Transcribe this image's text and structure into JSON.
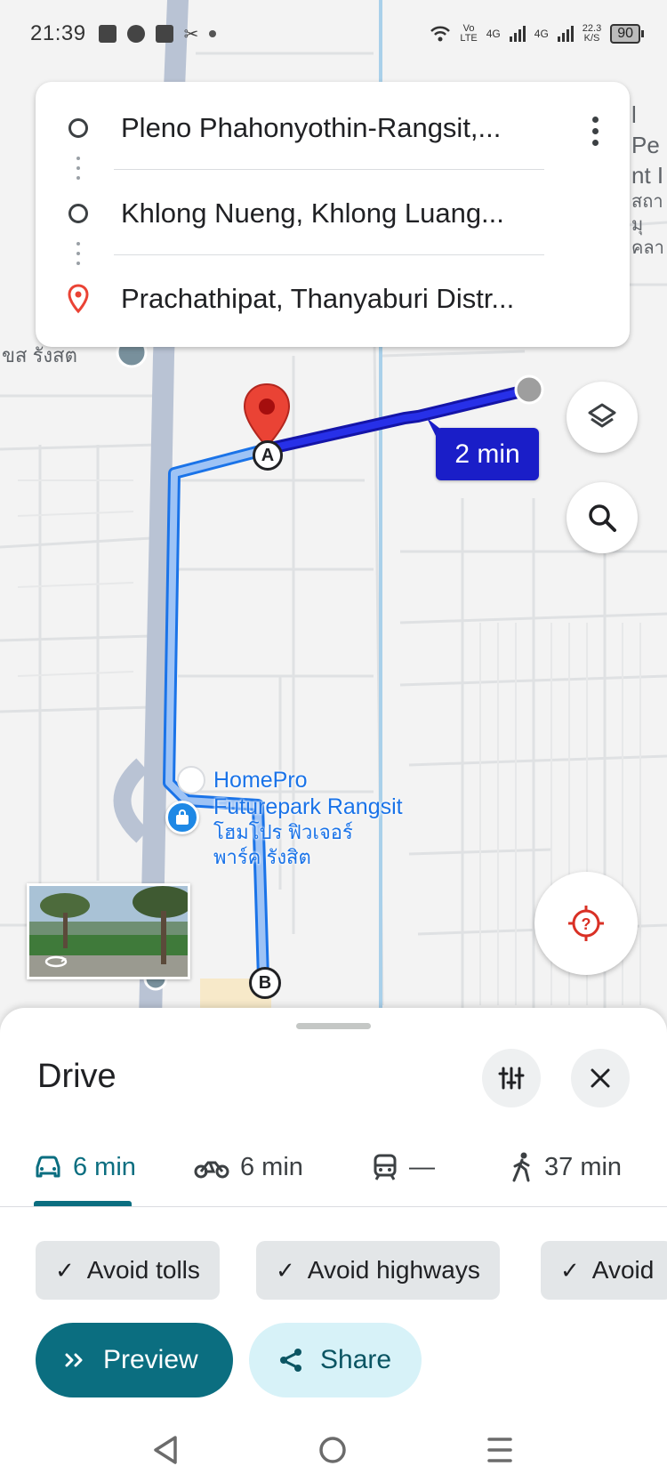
{
  "status_bar": {
    "time": "21:39",
    "net_vo": "Vo",
    "net_lte": "LTE",
    "sig1_label": "4G",
    "sig2_label": "4G",
    "speed": "22.3",
    "speed_unit": "K/S",
    "battery": "90"
  },
  "directions": {
    "origin": "Pleno Phahonyothin-Rangsit,...",
    "waypoint": "Khlong Nueng, Khlong Luang...",
    "destination": "Prachathipat, Thanyaburi Distr..."
  },
  "map": {
    "eta_label": "2 min",
    "poi_name_en_1": "HomePro",
    "poi_name_en_2": "Futurepark Rangsit",
    "poi_name_th_1": "โฮมโปร ฟิวเจอร์",
    "poi_name_th_2": "พาร์ค รังสิต",
    "street_thai": "ขส รังสต",
    "right_edge_1": "l Pe",
    "right_edge_2": "nt I",
    "right_edge_3": "สถา",
    "right_edge_4": "มุคลา",
    "marker_a": "A",
    "marker_b": "B"
  },
  "sheet": {
    "title": "Drive",
    "modes": [
      {
        "icon": "car-icon",
        "label": "6 min",
        "active": true
      },
      {
        "icon": "motorcycle-icon",
        "label": "6 min",
        "active": false
      },
      {
        "icon": "transit-icon",
        "label": "—",
        "active": false
      },
      {
        "icon": "walk-icon",
        "label": "37 min",
        "active": false
      }
    ],
    "chips": [
      "Avoid tolls",
      "Avoid highways",
      "Avoid"
    ],
    "preview_label": "Preview",
    "share_label": "Share"
  },
  "colors": {
    "route_primary": "#1a1ec8",
    "route_alt": "#9ec3f5",
    "accent_teal": "#0b6e80",
    "pin_red": "#ea4335",
    "poi_blue": "#1a73e8"
  }
}
